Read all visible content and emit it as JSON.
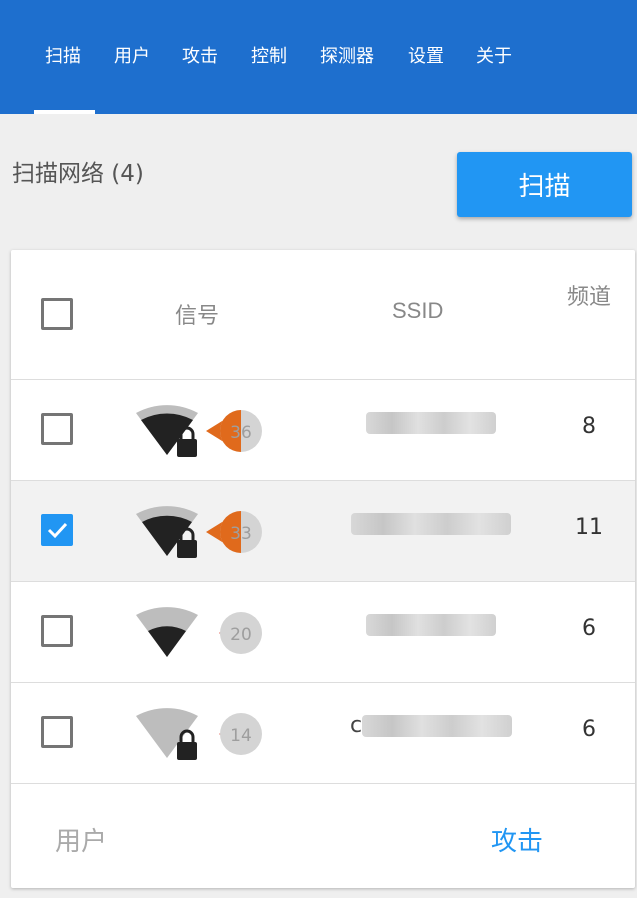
{
  "nav": {
    "tabs": [
      {
        "label": "扫描"
      },
      {
        "label": "用户"
      },
      {
        "label": "攻击"
      },
      {
        "label": "控制"
      },
      {
        "label": "探测器"
      },
      {
        "label": "设置"
      },
      {
        "label": "关于"
      }
    ],
    "active_index": 0
  },
  "scan": {
    "title": "扫描网络 (4)",
    "button_label": "扫描"
  },
  "table": {
    "headers": {
      "signal": "信号",
      "ssid": "SSID",
      "channel": "频道"
    },
    "rows": [
      {
        "checked": false,
        "signal_value": "36",
        "signal_level": 0.9,
        "locked": true,
        "ssid_visible_start": "",
        "ssid_visible_end": "",
        "channel": "8",
        "triangle_color": "#e06a1c"
      },
      {
        "checked": true,
        "signal_value": "33",
        "signal_level": 0.85,
        "locked": true,
        "ssid_visible_start": "",
        "ssid_visible_end": "",
        "channel": "11",
        "triangle_color": "#e06a1c"
      },
      {
        "checked": false,
        "signal_value": "20",
        "signal_level": 0.6,
        "locked": false,
        "ssid_visible_start": "",
        "ssid_visible_end": "",
        "channel": "6",
        "triangle_color": "#d63a2a"
      },
      {
        "checked": false,
        "signal_value": "14",
        "signal_level": 0.0,
        "locked": true,
        "ssid_visible_start": "c",
        "ssid_visible_end": "",
        "channel": "6",
        "triangle_color": "#d63a2a"
      }
    ]
  },
  "footer": {
    "users_label": "用户",
    "attack_label": "攻击"
  },
  "colors": {
    "topbar": "#1e6fce",
    "accent": "#2196f3"
  }
}
